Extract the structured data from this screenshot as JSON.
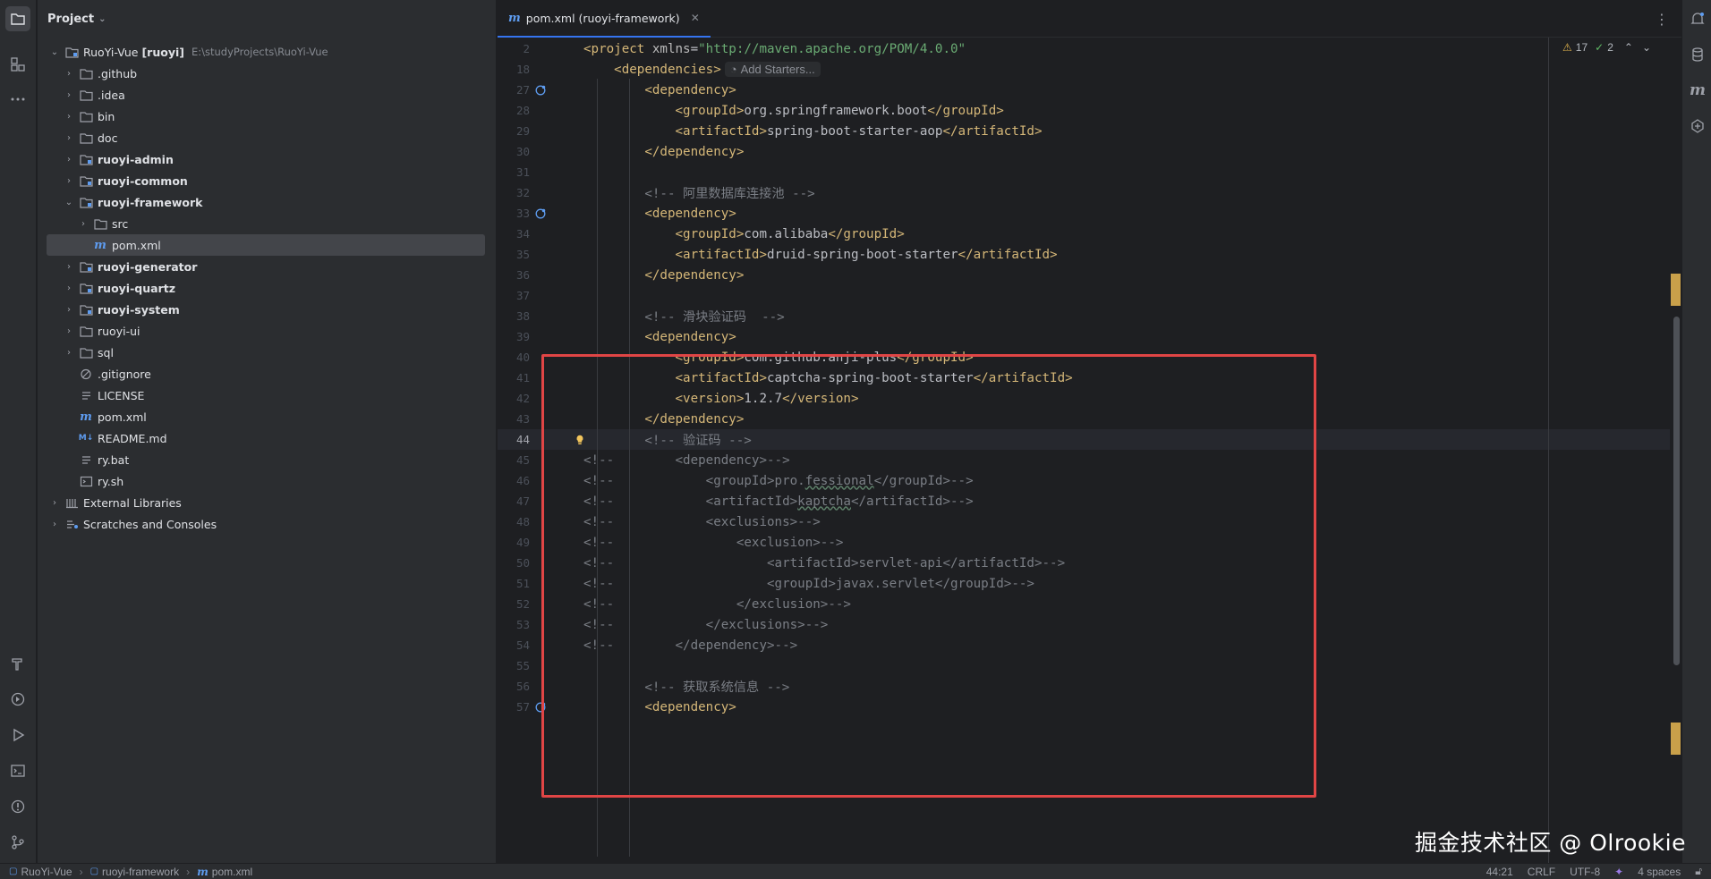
{
  "project_panel": {
    "title": "Project",
    "root": {
      "name": "RuoYi-Vue",
      "module": "[ruoyi]",
      "path": "E:\\studyProjects\\RuoYi-Vue"
    },
    "items": [
      {
        "label": ".github",
        "bold": false,
        "kind": "folder",
        "chevron": "›",
        "level": 1
      },
      {
        "label": ".idea",
        "bold": false,
        "kind": "folder",
        "chevron": "›",
        "level": 1
      },
      {
        "label": "bin",
        "bold": false,
        "kind": "folder",
        "chevron": "›",
        "level": 1
      },
      {
        "label": "doc",
        "bold": false,
        "kind": "folder",
        "chevron": "›",
        "level": 1
      },
      {
        "label": "ruoyi-admin",
        "bold": true,
        "kind": "module",
        "chevron": "›",
        "level": 1
      },
      {
        "label": "ruoyi-common",
        "bold": true,
        "kind": "module",
        "chevron": "›",
        "level": 1
      },
      {
        "label": "ruoyi-framework",
        "bold": true,
        "kind": "module",
        "chevron": "⌄",
        "level": 1
      },
      {
        "label": "src",
        "bold": false,
        "kind": "folder",
        "chevron": "›",
        "level": 2
      },
      {
        "label": "pom.xml",
        "bold": false,
        "kind": "maven",
        "chevron": "",
        "level": 2,
        "selected": true
      },
      {
        "label": "ruoyi-generator",
        "bold": true,
        "kind": "module",
        "chevron": "›",
        "level": 1
      },
      {
        "label": "ruoyi-quartz",
        "bold": true,
        "kind": "module",
        "chevron": "›",
        "level": 1
      },
      {
        "label": "ruoyi-system",
        "bold": true,
        "kind": "module",
        "chevron": "›",
        "level": 1
      },
      {
        "label": "ruoyi-ui",
        "bold": false,
        "kind": "folder",
        "chevron": "›",
        "level": 1
      },
      {
        "label": "sql",
        "bold": false,
        "kind": "folder",
        "chevron": "›",
        "level": 1
      },
      {
        "label": ".gitignore",
        "bold": false,
        "kind": "ignore",
        "chevron": "",
        "level": 1
      },
      {
        "label": "LICENSE",
        "bold": false,
        "kind": "text",
        "chevron": "",
        "level": 1
      },
      {
        "label": "pom.xml",
        "bold": false,
        "kind": "maven",
        "chevron": "",
        "level": 1
      },
      {
        "label": "README.md",
        "bold": false,
        "kind": "markdown",
        "chevron": "",
        "level": 1
      },
      {
        "label": "ry.bat",
        "bold": false,
        "kind": "text",
        "chevron": "",
        "level": 1
      },
      {
        "label": "ry.sh",
        "bold": false,
        "kind": "shell",
        "chevron": "",
        "level": 1
      },
      {
        "label": "External Libraries",
        "bold": false,
        "kind": "library",
        "chevron": "›",
        "level": 0
      },
      {
        "label": "Scratches and Consoles",
        "bold": false,
        "kind": "scratch",
        "chevron": "›",
        "level": 0
      }
    ]
  },
  "editor": {
    "tab_label": "pom.xml (ruoyi-framework)",
    "inspections": {
      "warnings": "17",
      "ok": "2"
    },
    "add_starters": "Add Starters...",
    "current_line": "44",
    "lines": [
      {
        "n": "2",
        "tokens": [
          [
            "tag",
            "<project "
          ],
          [
            "attr",
            "xmlns"
          ],
          [
            "txt",
            "="
          ],
          [
            "str",
            "\"http://maven.apache.org/POM/4.0.0\""
          ],
          [
            "tag",
            ""
          ]
        ],
        "indent": ""
      },
      {
        "n": "18",
        "tokens": [
          [
            "tag",
            "<dependencies>"
          ]
        ],
        "indent": "    ",
        "chip": true
      },
      {
        "n": "27",
        "tokens": [
          [
            "tag",
            "<dependency>"
          ]
        ],
        "indent": "        ",
        "gutter": "maven"
      },
      {
        "n": "28",
        "tokens": [
          [
            "tag",
            "<groupId>"
          ],
          [
            "txt",
            "org.springframework.boot"
          ],
          [
            "tag",
            "</groupId>"
          ]
        ],
        "indent": "            "
      },
      {
        "n": "29",
        "tokens": [
          [
            "tag",
            "<artifactId>"
          ],
          [
            "txt",
            "spring-boot-starter-aop"
          ],
          [
            "tag",
            "</artifactId>"
          ]
        ],
        "indent": "            "
      },
      {
        "n": "30",
        "tokens": [
          [
            "tag",
            "</dependency>"
          ]
        ],
        "indent": "        "
      },
      {
        "n": "31",
        "tokens": [],
        "indent": ""
      },
      {
        "n": "32",
        "tokens": [
          [
            "com",
            "<!-- 阿里数据库连接池 -->"
          ]
        ],
        "indent": "        "
      },
      {
        "n": "33",
        "tokens": [
          [
            "tag",
            "<dependency>"
          ]
        ],
        "indent": "        ",
        "gutter": "maven"
      },
      {
        "n": "34",
        "tokens": [
          [
            "tag",
            "<groupId>"
          ],
          [
            "txt",
            "com.alibaba"
          ],
          [
            "tag",
            "</groupId>"
          ]
        ],
        "indent": "            "
      },
      {
        "n": "35",
        "tokens": [
          [
            "tag",
            "<artifactId>"
          ],
          [
            "txt",
            "druid-spring-boot-starter"
          ],
          [
            "tag",
            "</artifactId>"
          ]
        ],
        "indent": "            "
      },
      {
        "n": "36",
        "tokens": [
          [
            "tag",
            "</dependency>"
          ]
        ],
        "indent": "        "
      },
      {
        "n": "37",
        "tokens": [],
        "indent": ""
      },
      {
        "n": "38",
        "tokens": [
          [
            "com",
            "<!-- 滑块验证码  -->"
          ]
        ],
        "indent": "        "
      },
      {
        "n": "39",
        "tokens": [
          [
            "tag",
            "<dependency>"
          ]
        ],
        "indent": "        "
      },
      {
        "n": "40",
        "tokens": [
          [
            "tag",
            "<groupId>"
          ],
          [
            "txt",
            "com.github.anji-plus"
          ],
          [
            "tag",
            "</groupId>"
          ]
        ],
        "indent": "            "
      },
      {
        "n": "41",
        "tokens": [
          [
            "tag",
            "<artifactId>"
          ],
          [
            "txt",
            "captcha-spring-boot-starter"
          ],
          [
            "tag",
            "</artifactId>"
          ]
        ],
        "indent": "            "
      },
      {
        "n": "42",
        "tokens": [
          [
            "tag",
            "<version>"
          ],
          [
            "txt",
            "1.2.7"
          ],
          [
            "tag",
            "</version>"
          ]
        ],
        "indent": "            "
      },
      {
        "n": "43",
        "tokens": [
          [
            "tag",
            "</dependency>"
          ]
        ],
        "indent": "        "
      },
      {
        "n": "44",
        "tokens": [
          [
            "com",
            "<!-- 验证码 -->"
          ]
        ],
        "indent": "        ",
        "gutter": "bulb"
      },
      {
        "n": "45",
        "tokens": [
          [
            "com",
            "<!--        <dependency>-->"
          ]
        ],
        "indent": ""
      },
      {
        "n": "46",
        "tokens": [
          [
            "com",
            "<!--            <groupId>pro."
          ],
          [
            "squig",
            "fessional"
          ],
          [
            "com",
            "</groupId>-->"
          ]
        ],
        "indent": ""
      },
      {
        "n": "47",
        "tokens": [
          [
            "com",
            "<!--            <artifactId>"
          ],
          [
            "squig",
            "kaptcha"
          ],
          [
            "com",
            "</artifactId>-->"
          ]
        ],
        "indent": ""
      },
      {
        "n": "48",
        "tokens": [
          [
            "com",
            "<!--            <exclusions>-->"
          ]
        ],
        "indent": ""
      },
      {
        "n": "49",
        "tokens": [
          [
            "com",
            "<!--                <exclusion>-->"
          ]
        ],
        "indent": ""
      },
      {
        "n": "50",
        "tokens": [
          [
            "com",
            "<!--                    <artifactId>servlet-api</artifactId>-->"
          ]
        ],
        "indent": ""
      },
      {
        "n": "51",
        "tokens": [
          [
            "com",
            "<!--                    <groupId>javax.servlet</groupId>-->"
          ]
        ],
        "indent": ""
      },
      {
        "n": "52",
        "tokens": [
          [
            "com",
            "<!--                </exclusion>-->"
          ]
        ],
        "indent": ""
      },
      {
        "n": "53",
        "tokens": [
          [
            "com",
            "<!--            </exclusions>-->"
          ]
        ],
        "indent": ""
      },
      {
        "n": "54",
        "tokens": [
          [
            "com",
            "<!--        </dependency>-->"
          ]
        ],
        "indent": ""
      },
      {
        "n": "55",
        "tokens": [],
        "indent": ""
      },
      {
        "n": "56",
        "tokens": [
          [
            "com",
            "<!-- 获取系统信息 -->"
          ]
        ],
        "indent": "        "
      },
      {
        "n": "57",
        "tokens": [
          [
            "tag",
            "<dependency>"
          ]
        ],
        "indent": "        ",
        "gutter": "maven"
      }
    ]
  },
  "watermark": "掘金技术社区 @ Olrookie",
  "statusbar": {
    "crumbs": [
      "RuoYi-Vue",
      "ruoyi-framework",
      "pom.xml"
    ],
    "position": "44:21",
    "line_ending": "CRLF",
    "encoding": "UTF-8",
    "indent": "4 spaces"
  },
  "colors": {
    "accent": "#3574f0",
    "highlight_box": "#e04545",
    "tag": "#d5b778",
    "string": "#6aab73",
    "comment": "#7a7e85"
  }
}
